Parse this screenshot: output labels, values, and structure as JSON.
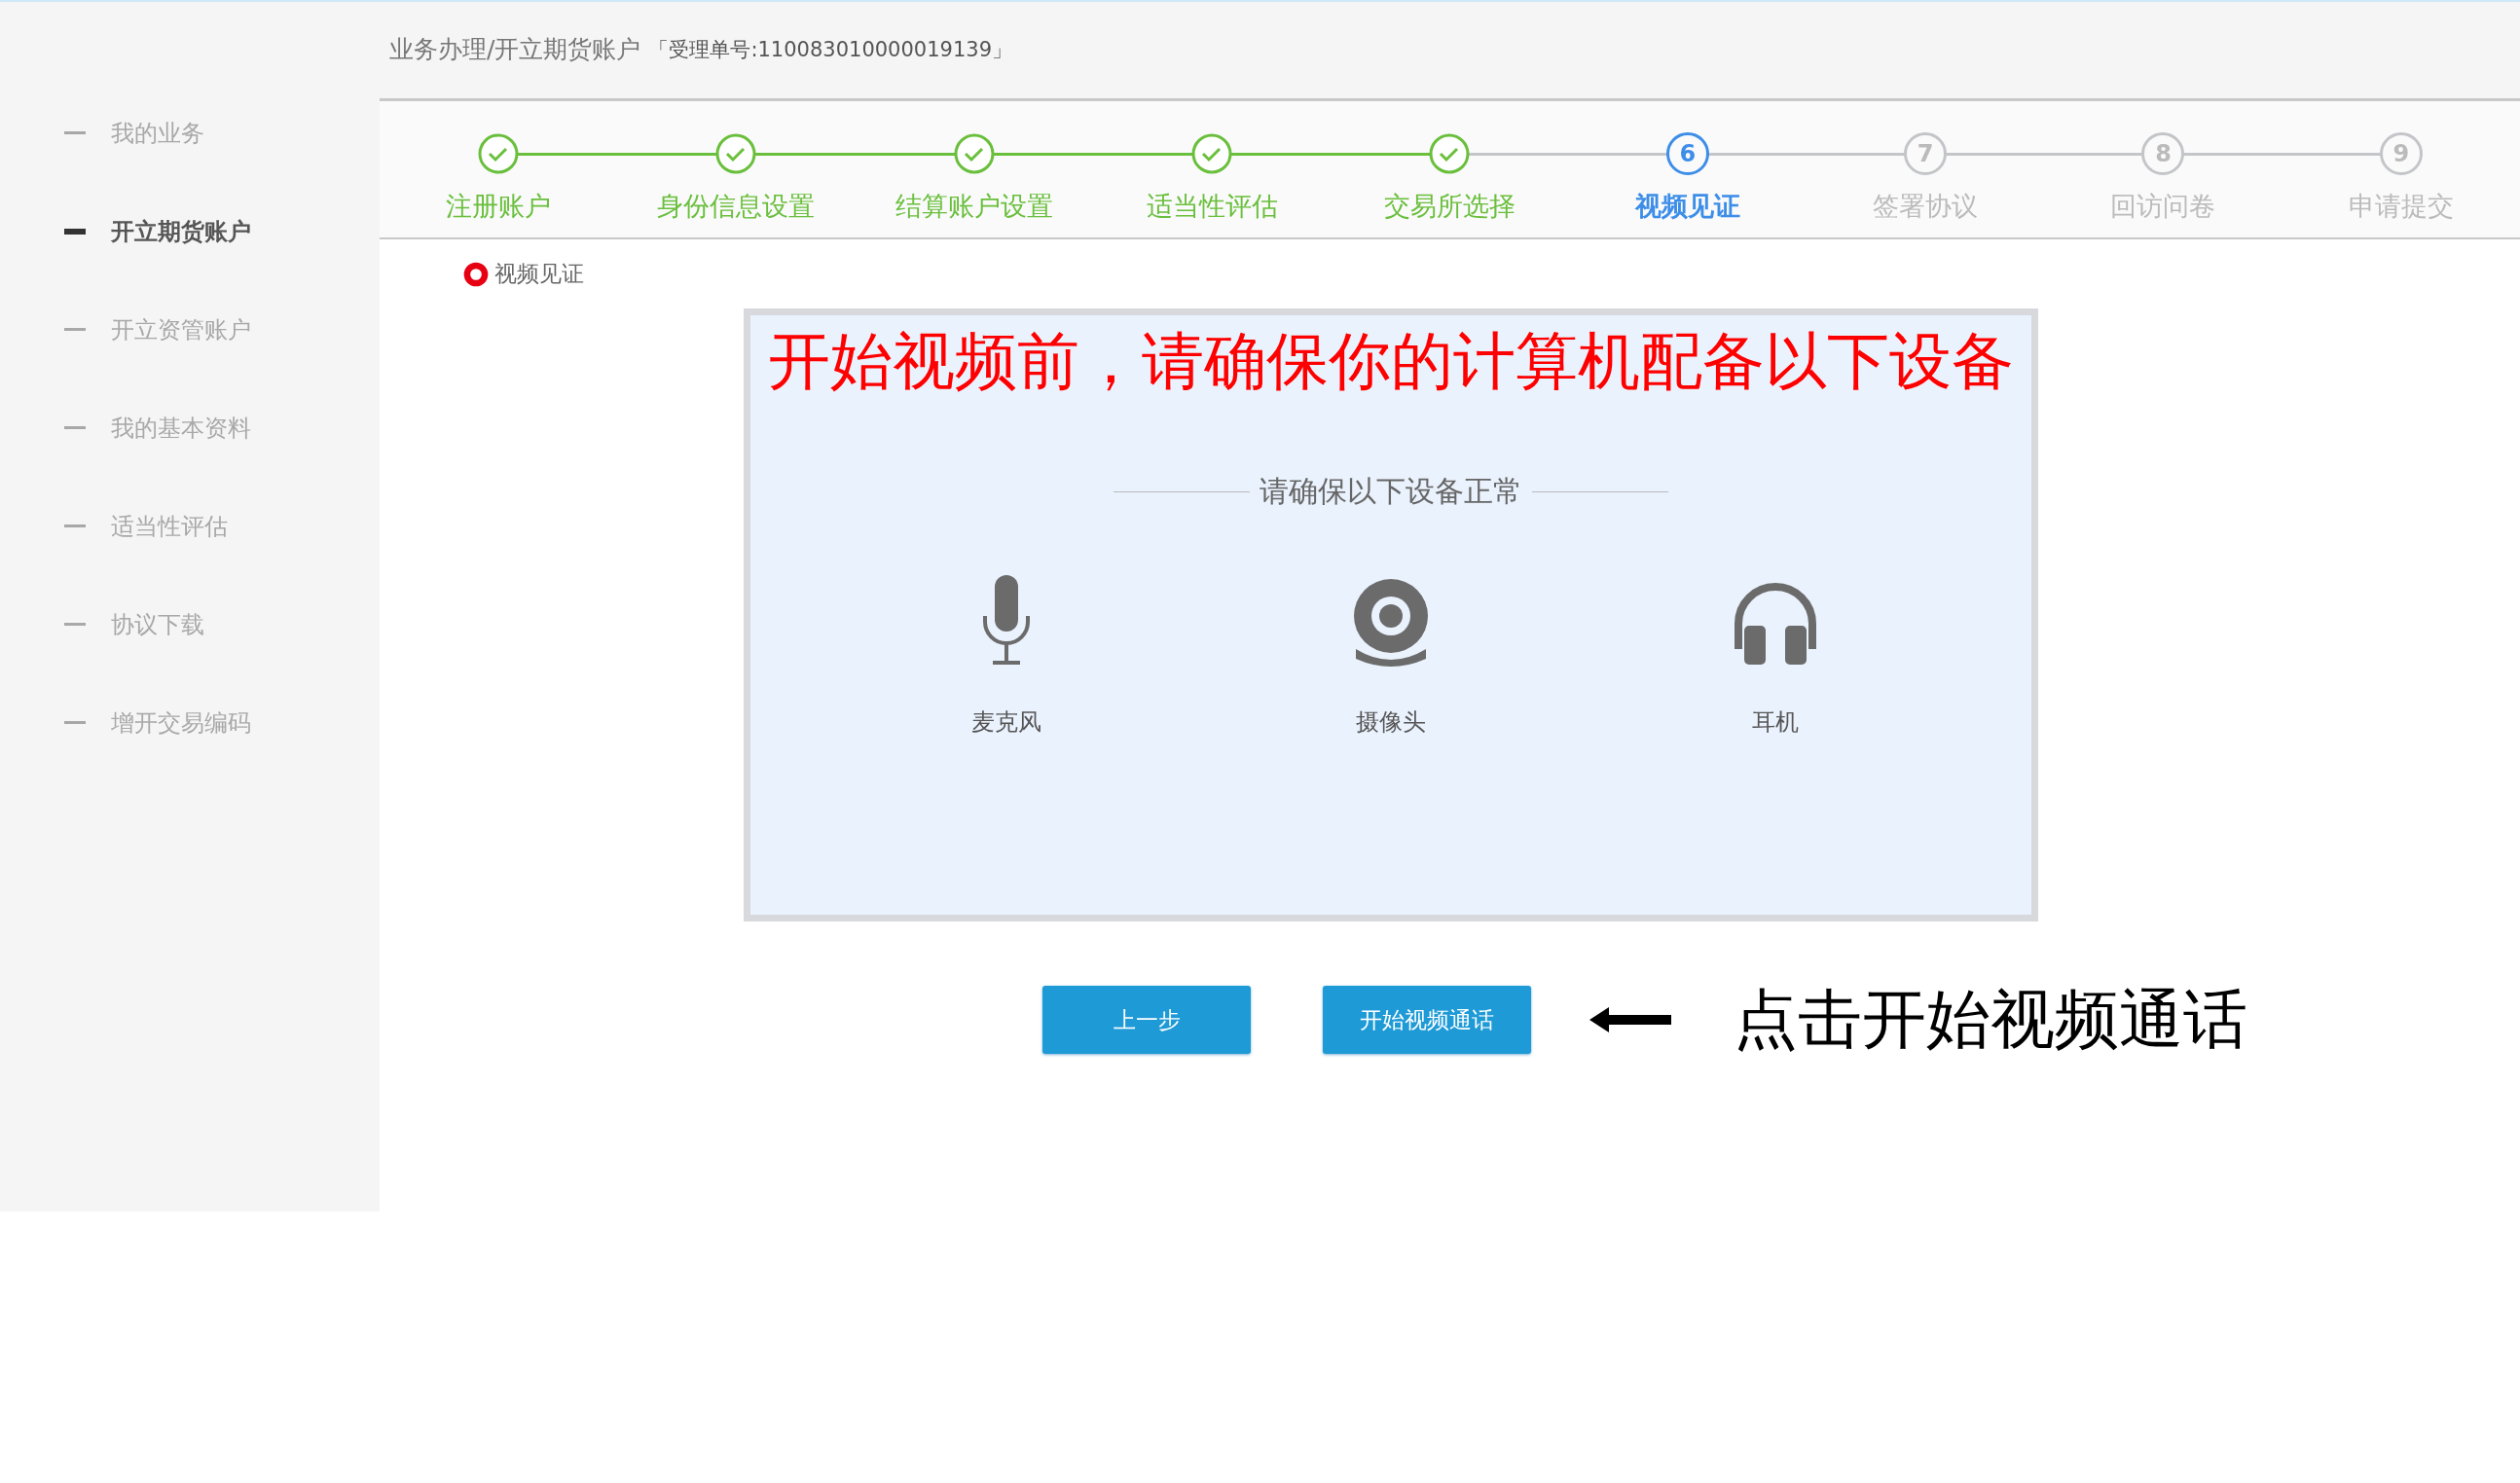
{
  "sidebar": {
    "items": [
      {
        "label": "我的业务",
        "selected": false
      },
      {
        "label": "开立期货账户",
        "selected": true
      },
      {
        "label": "开立资管账户",
        "selected": false
      },
      {
        "label": "我的基本资料",
        "selected": false
      },
      {
        "label": "适当性评估",
        "selected": false
      },
      {
        "label": "协议下载",
        "selected": false
      },
      {
        "label": "增开交易编码",
        "selected": false
      }
    ]
  },
  "breadcrumb": {
    "path": "业务办理/开立期货账户",
    "order_number": "「受理单号:110083010000019139」"
  },
  "steps": [
    {
      "label": "注册账户",
      "completed": true,
      "selected": false
    },
    {
      "label": "身份信息设置",
      "completed": true,
      "selected": false
    },
    {
      "label": "结算账户设置",
      "completed": true,
      "selected": false
    },
    {
      "label": "适当性评估",
      "completed": true,
      "selected": false
    },
    {
      "label": "交易所选择",
      "completed": true,
      "selected": false
    },
    {
      "label": "视频见证",
      "completed": false,
      "selected": true,
      "number": "6"
    },
    {
      "label": "签署协议",
      "completed": false,
      "selected": false,
      "number": "7"
    },
    {
      "label": "回访问卷",
      "completed": false,
      "selected": false,
      "number": "8"
    },
    {
      "label": "申请提交",
      "completed": false,
      "selected": false,
      "number": "9"
    }
  ],
  "section_title": "视频见证",
  "notice_panel": {
    "heading": "开始视频前，请确保你的计算机配备以下设备",
    "subheading": "请确保以下设备正常",
    "devices": [
      {
        "kind": "microphone",
        "label": "麦克风"
      },
      {
        "kind": "camera",
        "label": "摄像头"
      },
      {
        "kind": "headphones",
        "label": "耳机"
      }
    ]
  },
  "buttons": [
    "上一步",
    "开始视频通话"
  ],
  "annotation": "点击开始视频通话"
}
